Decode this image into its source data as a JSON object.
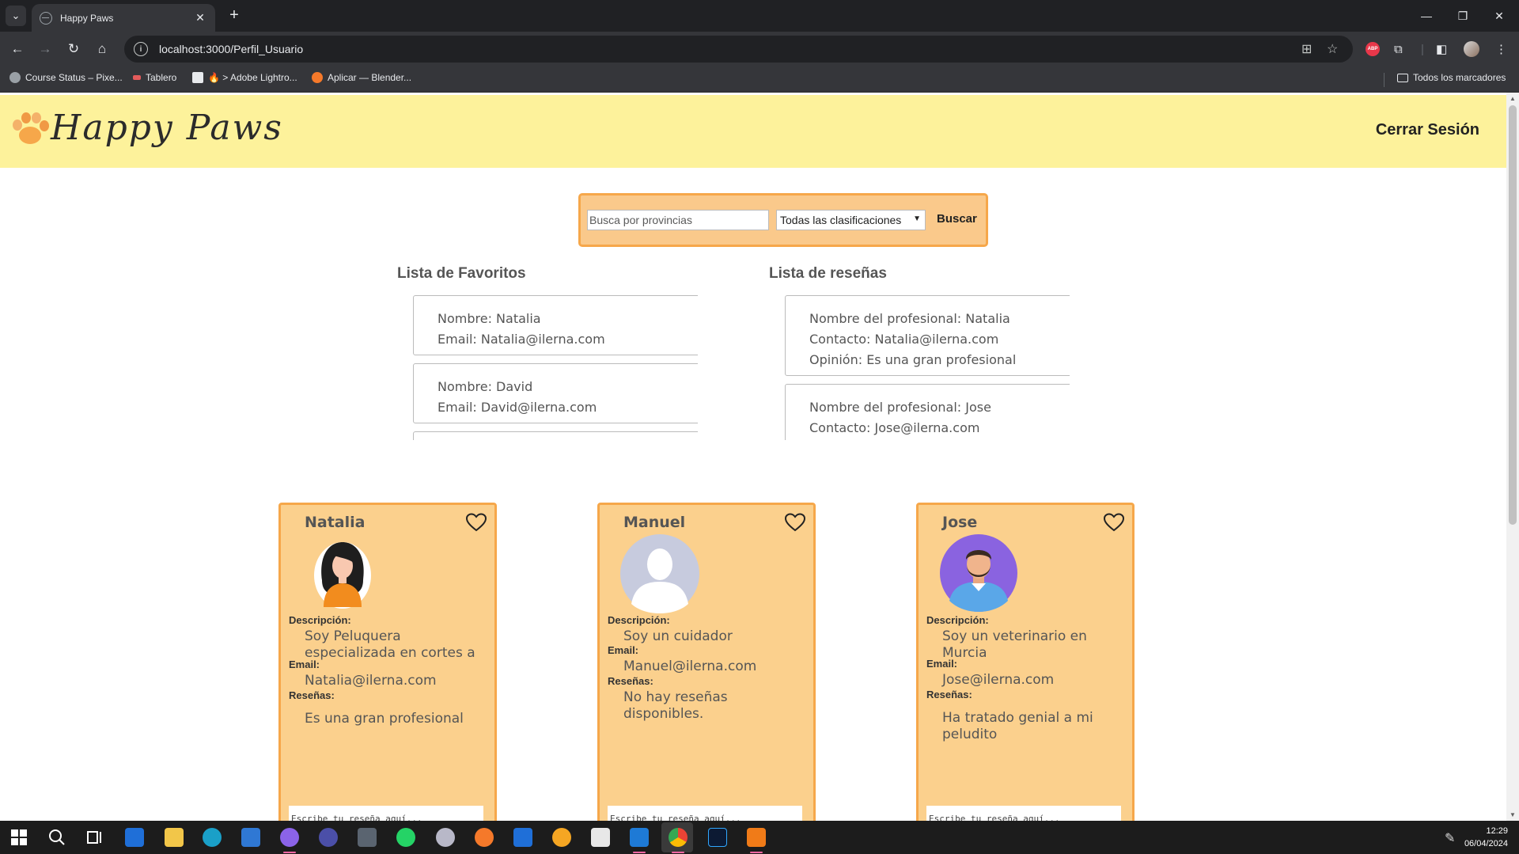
{
  "browser": {
    "tab_title": "Happy Paws",
    "url": "localhost:3000/Perfil_Usuario",
    "bookmarks": [
      "Course Status – Pixe...",
      "Tablero",
      "🔥 > Adobe Lightro...",
      "Aplicar — Blender..."
    ],
    "all_bookmarks": "Todos los marcadores"
  },
  "header": {
    "logo_text": "Happy Paws",
    "logout": "Cerrar Sesión"
  },
  "search": {
    "placeholder": "Busca por provincias",
    "select_value": "Todas las clasificaciones",
    "button": "Buscar"
  },
  "favorites": {
    "title": "Lista de Favoritos",
    "items": [
      {
        "name": "Nombre: Natalia",
        "email": "Email: Natalia@ilerna.com"
      },
      {
        "name": "Nombre: David",
        "email": "Email: David@ilerna.com"
      }
    ]
  },
  "reviews": {
    "title": "Lista de reseñas",
    "items": [
      {
        "professional": "Nombre del profesional: Natalia",
        "contact": "Contacto: Natalia@ilerna.com",
        "opinion": "Opinión: Es una gran profesional"
      },
      {
        "professional": "Nombre del profesional: Jose",
        "contact": "Contacto: Jose@ilerna.com"
      }
    ]
  },
  "labels": {
    "description": "Descripción:",
    "email": "Email:",
    "reviews": "Reseñas:",
    "review_placeholder": "Escribe tu reseña aquí..."
  },
  "professionals": [
    {
      "name": "Natalia",
      "description": "Soy Peluquera especializada en cortes a",
      "email": "Natalia@ilerna.com",
      "review": "Es una gran profesional"
    },
    {
      "name": "Manuel",
      "description": "Soy un cuidador",
      "email": "Manuel@ilerna.com",
      "review": "No hay reseñas disponibles."
    },
    {
      "name": "Jose",
      "description": "Soy un veterinario en Murcia",
      "email": "Jose@ilerna.com",
      "review": "Ha tratado genial a mi peludito"
    }
  ],
  "taskbar": {
    "time": "12:29",
    "date": "06/04/2024"
  },
  "colors": {
    "header_bg": "#fdf29b",
    "card_bg": "#fbd08d",
    "card_border": "#f6a74a"
  }
}
